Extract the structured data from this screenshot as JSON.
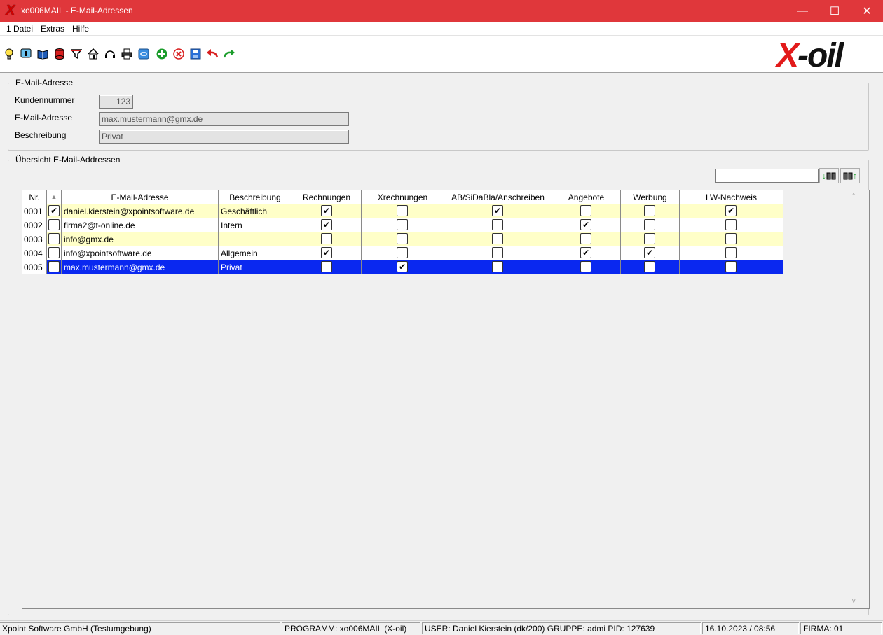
{
  "window": {
    "app_mark": "X",
    "title": "xo006MAIL - E-Mail-Adressen",
    "minimize": "—",
    "maximize": "☐",
    "close": "✕"
  },
  "menu": [
    "1 Datei",
    "Extras",
    "Hilfe"
  ],
  "toolbar": {
    "icons": [
      "lightbulb-icon",
      "info-icon",
      "book-icon",
      "database-icon",
      "filter-icon",
      "home-icon",
      "headset-icon",
      "printer-icon",
      "link-icon",
      "add-icon",
      "delete-icon",
      "save-icon",
      "undo-icon",
      "redo-icon"
    ],
    "logo_x": "X",
    "logo_rest": "-oil"
  },
  "email_group": {
    "title": "E-Mail-Adresse",
    "kundennummer_label": "Kundennummer",
    "kundennummer_value": "123",
    "email_label": "E-Mail-Adresse",
    "email_value": "max.mustermann@gmx.de",
    "beschreibung_label": "Beschreibung",
    "beschreibung_value": "Privat"
  },
  "overview_group": {
    "title": "Übersicht E-Mail-Addressen",
    "search_value": "",
    "search_down_label": "↓",
    "search_up_label": "↑"
  },
  "grid": {
    "columns": [
      "Nr.",
      "▲",
      "E-Mail-Adresse",
      "Beschreibung",
      "Rechnungen",
      "Xrechnungen",
      "AB/SiDaBla/Anschreiben",
      "Angebote",
      "Werbung",
      "LW-Nachweis"
    ],
    "rows": [
      {
        "nr": "0001",
        "sel": true,
        "email": "daniel.kierstein@xpointsoftware.de",
        "beschreibung": "Geschäftlich",
        "flags": [
          true,
          false,
          true,
          false,
          false,
          true
        ],
        "style": "yellow"
      },
      {
        "nr": "0002",
        "sel": false,
        "email": "firma2@t-online.de",
        "beschreibung": "Intern",
        "flags": [
          true,
          false,
          false,
          true,
          false,
          false
        ],
        "style": "white"
      },
      {
        "nr": "0003",
        "sel": false,
        "email": "info@gmx.de",
        "beschreibung": "",
        "flags": [
          false,
          false,
          false,
          false,
          false,
          false
        ],
        "style": "yellow"
      },
      {
        "nr": "0004",
        "sel": false,
        "email": "info@xpointsoftware.de",
        "beschreibung": "Allgemein",
        "flags": [
          true,
          false,
          false,
          true,
          true,
          false
        ],
        "style": "white"
      },
      {
        "nr": "0005",
        "sel": false,
        "email": "max.mustermann@gmx.de",
        "beschreibung": "Privat",
        "flags": [
          false,
          true,
          false,
          false,
          false,
          false
        ],
        "style": "sel"
      }
    ]
  },
  "statusbar": {
    "company": "Xpoint Software GmbH (Testumgebung)",
    "program": "PROGRAMM: xo006MAIL (X-oil)",
    "user": "USER: Daniel Kierstein (dk/200)  GRUPPE: admi  PID: 127639",
    "datetime": "16.10.2023 / 08:56",
    "firma": "FIRMA: 01"
  },
  "colors": {
    "titlebar": "#e0373b",
    "row_yellow": "#ffffc8",
    "row_selected": "#0a28f0",
    "logo_red": "#e21a1a"
  }
}
